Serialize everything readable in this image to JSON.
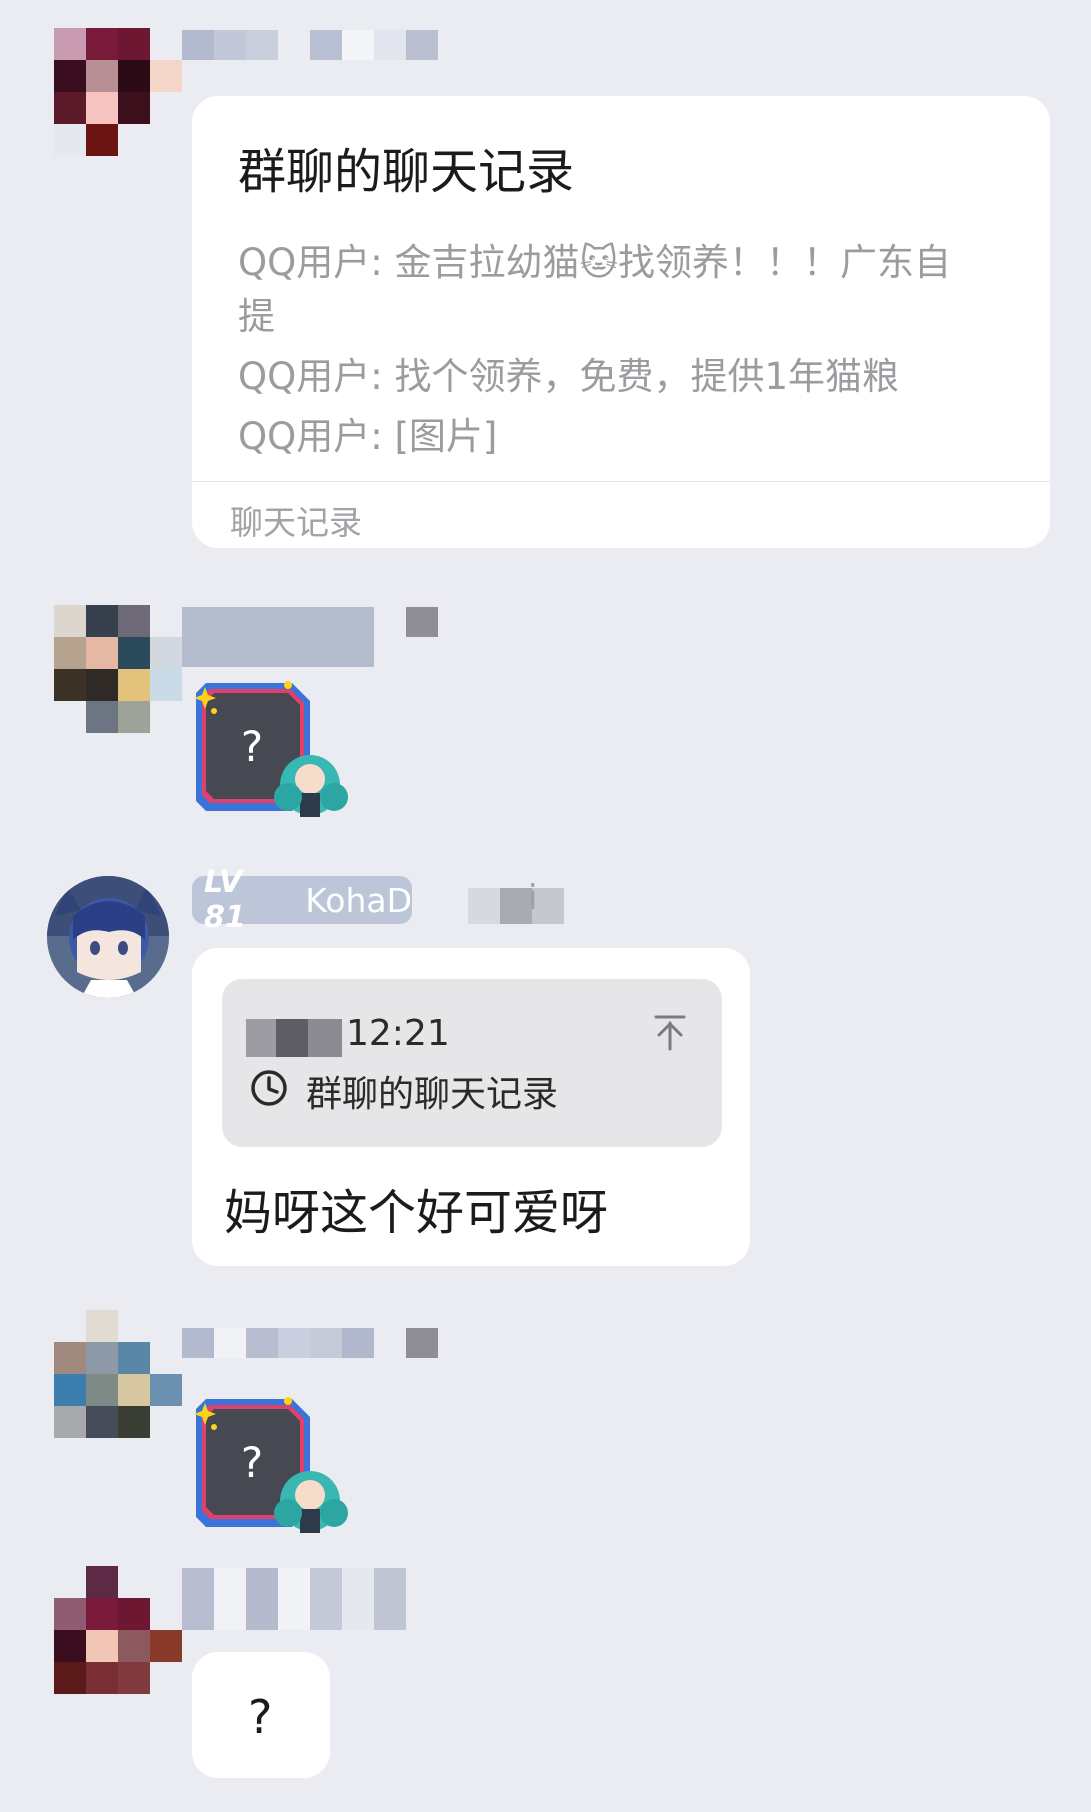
{
  "messages": [
    {
      "forward": {
        "title": "群聊的聊天记录",
        "lines": [
          "QQ用户: 金吉拉幼猫🐱找领养！！！广东自",
          "提",
          "QQ用户: 找个领养，免费，提供1年猫粮",
          "QQ用户: [图片]"
        ],
        "footer": "聊天记录"
      }
    },
    {
      "sticker": {
        "text": "?"
      }
    },
    {
      "sender": {
        "level": "LV 81",
        "name": "KohaD",
        "suffix": "i"
      },
      "quote": {
        "time": "12:21",
        "title": "群聊的聊天记录"
      },
      "text": "妈呀这个好可爱呀"
    },
    {
      "sticker": {
        "text": "?"
      }
    },
    {
      "text": "?"
    }
  ],
  "icons": {
    "clock": "clock-icon",
    "scroll_top": "scroll-to-top-icon"
  }
}
